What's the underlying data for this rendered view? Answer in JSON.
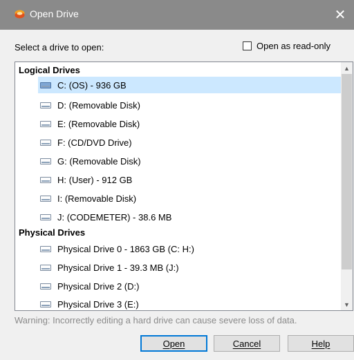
{
  "window": {
    "title": "Open Drive",
    "close_glyph": "✕",
    "app_icon": "open-drive-app-icon"
  },
  "prompt": "Select a drive to open:",
  "read_only": {
    "label": "Open as read-only",
    "checked": false
  },
  "drive_list": {
    "groups": [
      {
        "label": "Logical Drives",
        "items": [
          {
            "label": "C: (OS) - 936 GB",
            "selected": true
          },
          {
            "label": "D: (Removable Disk)",
            "selected": false
          },
          {
            "label": "E: (Removable Disk)",
            "selected": false
          },
          {
            "label": "F: (CD/DVD Drive)",
            "selected": false
          },
          {
            "label": "G: (Removable Disk)",
            "selected": false
          },
          {
            "label": "H: (User) - 912 GB",
            "selected": false
          },
          {
            "label": "I: (Removable Disk)",
            "selected": false
          },
          {
            "label": "J: (CODEMETER) - 38.6 MB",
            "selected": false
          }
        ]
      },
      {
        "label": "Physical Drives",
        "items": [
          {
            "label": "Physical Drive 0 - 1863 GB (C: H:)",
            "selected": false
          },
          {
            "label": "Physical Drive 1 - 39.3 MB (J:)",
            "selected": false
          },
          {
            "label": "Physical Drive 2 (D:)",
            "selected": false
          },
          {
            "label": "Physical Drive 3 (E:)",
            "selected": false
          }
        ]
      }
    ],
    "icon": "hard-drive-icon"
  },
  "warning": "Warning: Incorrectly editing a hard drive can cause severe loss of data.",
  "buttons": {
    "open": "Open",
    "cancel": "Cancel",
    "help": "Help"
  },
  "colors": {
    "titlebar": "#8a8a8a",
    "selection": "#cce8ff",
    "default_button_border": "#0078d7"
  }
}
